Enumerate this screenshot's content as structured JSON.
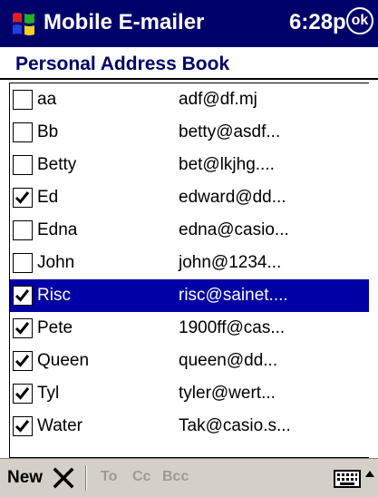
{
  "titlebar": {
    "app_title": "Mobile E-mailer",
    "time": "6:28p",
    "ok_label": "ok",
    "start_icon": "windows-flag-icon",
    "background": "#00006b"
  },
  "page": {
    "title": "Personal Address Book"
  },
  "colors": {
    "selection": "#0000a5",
    "heading": "#00006b",
    "disabled": "#9c9a94"
  },
  "contacts": [
    {
      "name": "aa",
      "email": "adf@df.mj",
      "checked": false,
      "selected": false
    },
    {
      "name": "Bb",
      "email": "betty@asdf...",
      "checked": false,
      "selected": false
    },
    {
      "name": "Betty",
      "email": "bet@lkjhg....",
      "checked": false,
      "selected": false
    },
    {
      "name": "Ed",
      "email": "edward@dd...",
      "checked": true,
      "selected": false
    },
    {
      "name": "Edna",
      "email": "edna@casio...",
      "checked": false,
      "selected": false
    },
    {
      "name": "John",
      "email": "john@1234...",
      "checked": false,
      "selected": false
    },
    {
      "name": "Risc",
      "email": "risc@sainet....",
      "checked": true,
      "selected": true
    },
    {
      "name": "Pete",
      "email": "1900ff@cas...",
      "checked": true,
      "selected": false
    },
    {
      "name": "Queen",
      "email": "queen@dd...",
      "checked": true,
      "selected": false
    },
    {
      "name": "Tyl",
      "email": "tyler@wert...",
      "checked": true,
      "selected": false
    },
    {
      "name": "Water",
      "email": "Tak@casio.s...",
      "checked": true,
      "selected": false
    }
  ],
  "commandbar": {
    "new_label": "New",
    "delete_icon": "delete-x-icon",
    "to_label": "To",
    "cc_label": "Cc",
    "bcc_label": "Bcc",
    "keyboard_icon": "keyboard-icon",
    "sip_arrow_icon": "up-arrow-icon"
  }
}
